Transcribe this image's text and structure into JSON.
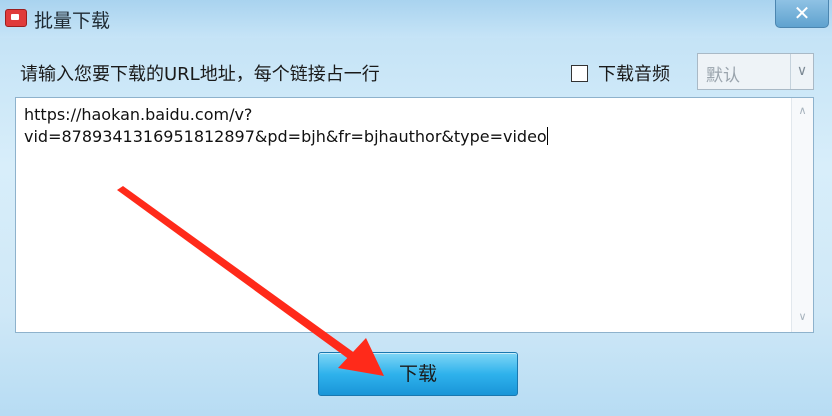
{
  "window": {
    "title": "批量下载",
    "close_symbol": "✕"
  },
  "form": {
    "instruction": "请输入您要下载的URL地址，每个链接占一行",
    "audio_checkbox": {
      "label": "下载音频",
      "checked": false
    },
    "quality_select": {
      "value": "默认"
    },
    "urls_text": "https://haokan.baidu.com/v?\nvid=8789341316951812897&pd=bjh&fr=bjhauthor&type=video",
    "download_label": "下载"
  },
  "annotation": {
    "arrow_color": "#ff2a1a"
  },
  "icons": {
    "app": "app-video-icon",
    "dropdown": "chevron-down-icon",
    "scroll_up": "scroll-up-icon",
    "scroll_down": "scroll-down-icon"
  }
}
